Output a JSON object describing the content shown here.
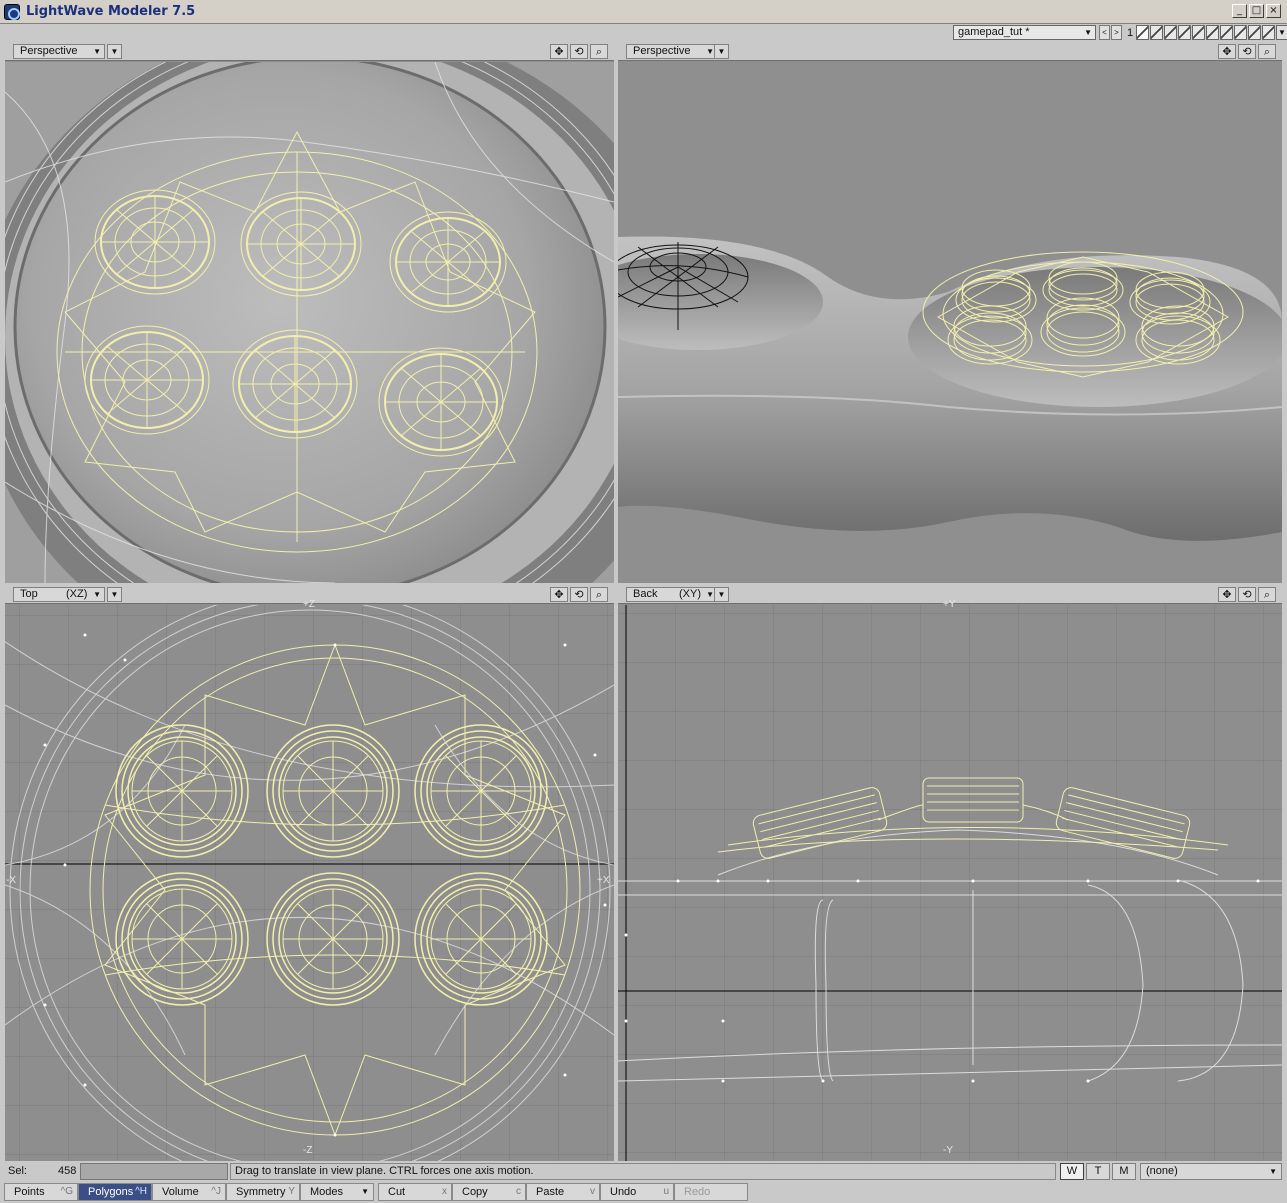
{
  "app": {
    "title": "LightWave Modeler 7.5",
    "window_controls": [
      "_",
      "□",
      "×"
    ]
  },
  "topbar": {
    "object_name": "gamepad_tut *",
    "layer_prev": "<",
    "layer_next": ">",
    "layer_number": "1"
  },
  "viewports": [
    {
      "id": "tl",
      "view": "Perspective",
      "plane": ""
    },
    {
      "id": "tr",
      "view": "Perspective",
      "plane": ""
    },
    {
      "id": "bl",
      "view": "Top",
      "plane": "(XZ)",
      "axis_top": "+Z",
      "axis_bottom": "-Z",
      "axis_left": "-X",
      "axis_right": "+X"
    },
    {
      "id": "br",
      "view": "Back",
      "plane": "(XY)",
      "axis_top": "+Y",
      "axis_bottom": "-Y"
    }
  ],
  "viewport_tools": [
    "move-view",
    "rotate-view",
    "zoom-view"
  ],
  "status": {
    "sel_label": "Sel:",
    "sel_count": "458",
    "hint": "Drag to translate in view plane. CTRL forces one axis motion.",
    "wtm": [
      "W",
      "T",
      "M"
    ],
    "surface": "(none)"
  },
  "modebar": [
    {
      "label": "Points",
      "shortcut": "^G"
    },
    {
      "label": "Polygons",
      "shortcut": "^H",
      "active": true
    },
    {
      "label": "Volume",
      "shortcut": "^J"
    },
    {
      "label": "Symmetry",
      "shortcut": "Y"
    },
    {
      "label": "Modes",
      "shortcut": ""
    },
    {
      "label": "Cut",
      "shortcut": "x"
    },
    {
      "label": "Copy",
      "shortcut": "c"
    },
    {
      "label": "Paste",
      "shortcut": "v"
    },
    {
      "label": "Undo",
      "shortcut": "u"
    },
    {
      "label": "Redo",
      "shortcut": "",
      "disabled": true
    }
  ],
  "colors": {
    "wire_selected": "#f2efad",
    "wire_unselected": "#e6e6e6",
    "viewport_bg": "#8e8e8e",
    "mode_active": "#3b4f86"
  }
}
